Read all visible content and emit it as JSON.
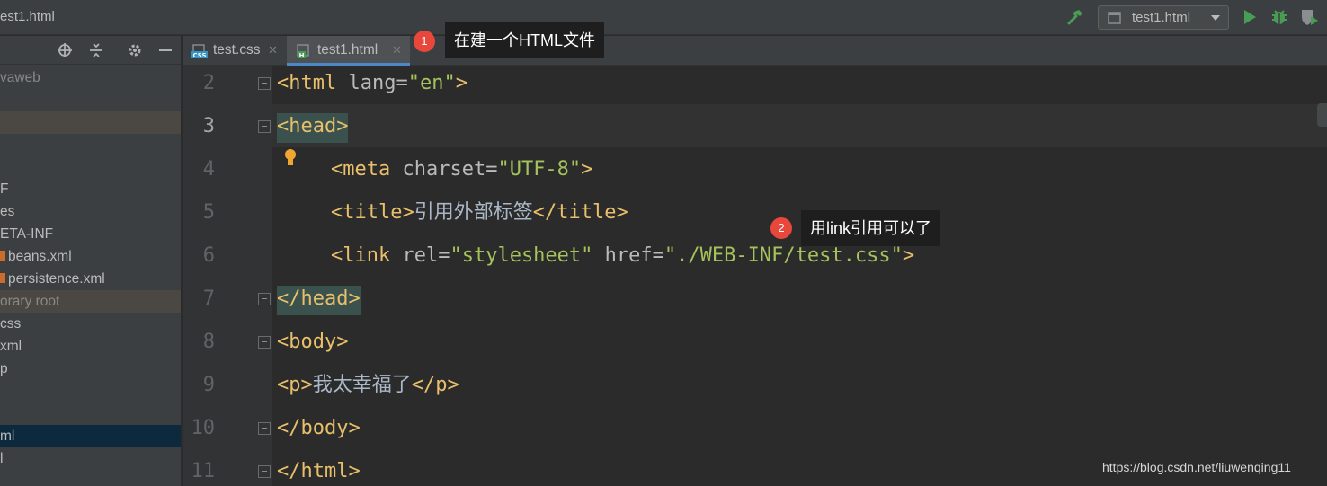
{
  "window": {
    "title": "est1.html"
  },
  "toolbar": {
    "run_config_label": "test1.html",
    "build_icon": "hammer-icon",
    "run_icon": "play-icon",
    "debug_icon": "bug-icon",
    "coverage_icon": "shield-run-icon"
  },
  "sidebar": {
    "items": [
      {
        "label": "vaweb",
        "style": "dim"
      },
      {
        "label": "",
        "style": "hl-brown"
      },
      {
        "label": "",
        "style": ""
      },
      {
        "label": "F",
        "style": ""
      },
      {
        "label": "es",
        "style": ""
      },
      {
        "label": "ETA-INF",
        "style": ""
      },
      {
        "label": "beans.xml",
        "style": "xml"
      },
      {
        "label": "persistence.xml",
        "style": "xml"
      },
      {
        "label": "orary root",
        "style": "dim-brown"
      },
      {
        "label": "css",
        "style": ""
      },
      {
        "label": "xml",
        "style": ""
      },
      {
        "label": "p",
        "style": ""
      },
      {
        "label": "",
        "style": ""
      },
      {
        "label": "ml",
        "style": "hl-blue"
      },
      {
        "label": "l",
        "style": ""
      }
    ]
  },
  "tabs": [
    {
      "label": "test.css",
      "active": false
    },
    {
      "label": "test1.html",
      "active": true
    }
  ],
  "editor": {
    "line_numbers": [
      "2",
      "3",
      "4",
      "5",
      "6",
      "7",
      "8",
      "9",
      "10",
      "11"
    ],
    "current_line": "3",
    "lines": {
      "l2": {
        "open": "<html",
        "attr": " lang=",
        "val": "\"en\"",
        "close": ">"
      },
      "l3": {
        "tag": "<head>"
      },
      "l4": {
        "open": "<meta",
        "attr": " charset=",
        "val": "\"UTF-8\"",
        "close": ">"
      },
      "l5": {
        "open": "<title>",
        "text": "引用外部标签",
        "close": "</title>"
      },
      "l6": {
        "open": "<link",
        "attr1": " rel=",
        "val1": "\"stylesheet\"",
        "attr2": " href=",
        "val2": "\"./WEB-INF/test.css\"",
        "close": ">"
      },
      "l7": {
        "tag": "</head>"
      },
      "l8": {
        "tag": "<body>"
      },
      "l9": {
        "open": "<p>",
        "text": "我太幸福了",
        "close": "</p>"
      },
      "l10": {
        "tag": "</body>"
      },
      "l11": {
        "tag": "</html>"
      }
    }
  },
  "annotations": [
    {
      "number": "1",
      "text": "在建一个HTML文件"
    },
    {
      "number": "2",
      "text": "用link引用可以了"
    }
  ],
  "watermark": "https://blog.csdn.net/liuwenqing11",
  "colors": {
    "tag": "#e8bf6a",
    "attribute": "#bababa",
    "string": "#a5c25c",
    "badge": "#e8473c",
    "active_tab_underline": "#4a88c7"
  }
}
